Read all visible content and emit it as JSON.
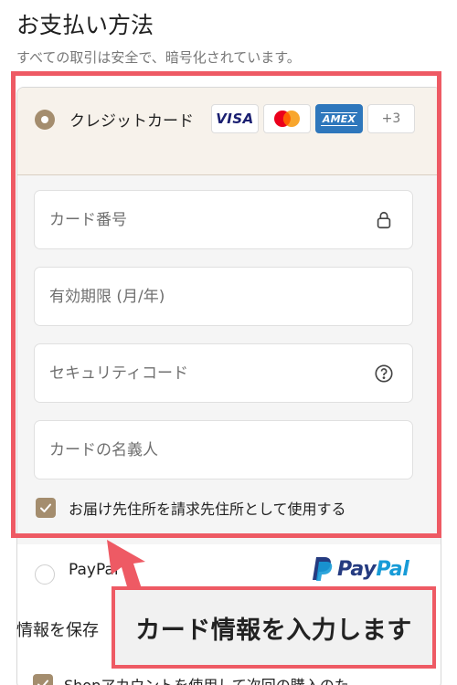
{
  "header": {
    "title": "お支払い方法",
    "subtitle": "すべての取引は安全で、暗号化されています。"
  },
  "payment": {
    "card_option": {
      "label": "クレジットカード",
      "selected": true,
      "brands": {
        "visa": "VISA",
        "amex": "AMEX",
        "more": "+3"
      }
    },
    "fields": {
      "card_number": {
        "placeholder": "カード番号",
        "value": ""
      },
      "expiry": {
        "placeholder": "有効期限 (月/年)",
        "value": ""
      },
      "security_code": {
        "placeholder": "セキュリティコード",
        "value": ""
      },
      "cardholder_name": {
        "placeholder": "カードの名義人",
        "value": ""
      }
    },
    "billing_same_as_shipping": {
      "label": "お届け先住所を請求先住所として使用する",
      "checked": true
    },
    "paypal_option": {
      "label": "PayPal",
      "logo_pay": "Pay",
      "logo_pal": "Pal",
      "selected": false
    }
  },
  "save_info": {
    "heading": "情報を保存",
    "shop_account_label": "Shopアカウントを使用して次回の購入のた"
  },
  "annotation": {
    "callout_text": "カード情報を入力します"
  },
  "colors": {
    "accent": "#a48d6e",
    "highlight": "#ee5a64",
    "selected_bg": "#f7f2eb",
    "form_bg": "#f5f5f5"
  }
}
